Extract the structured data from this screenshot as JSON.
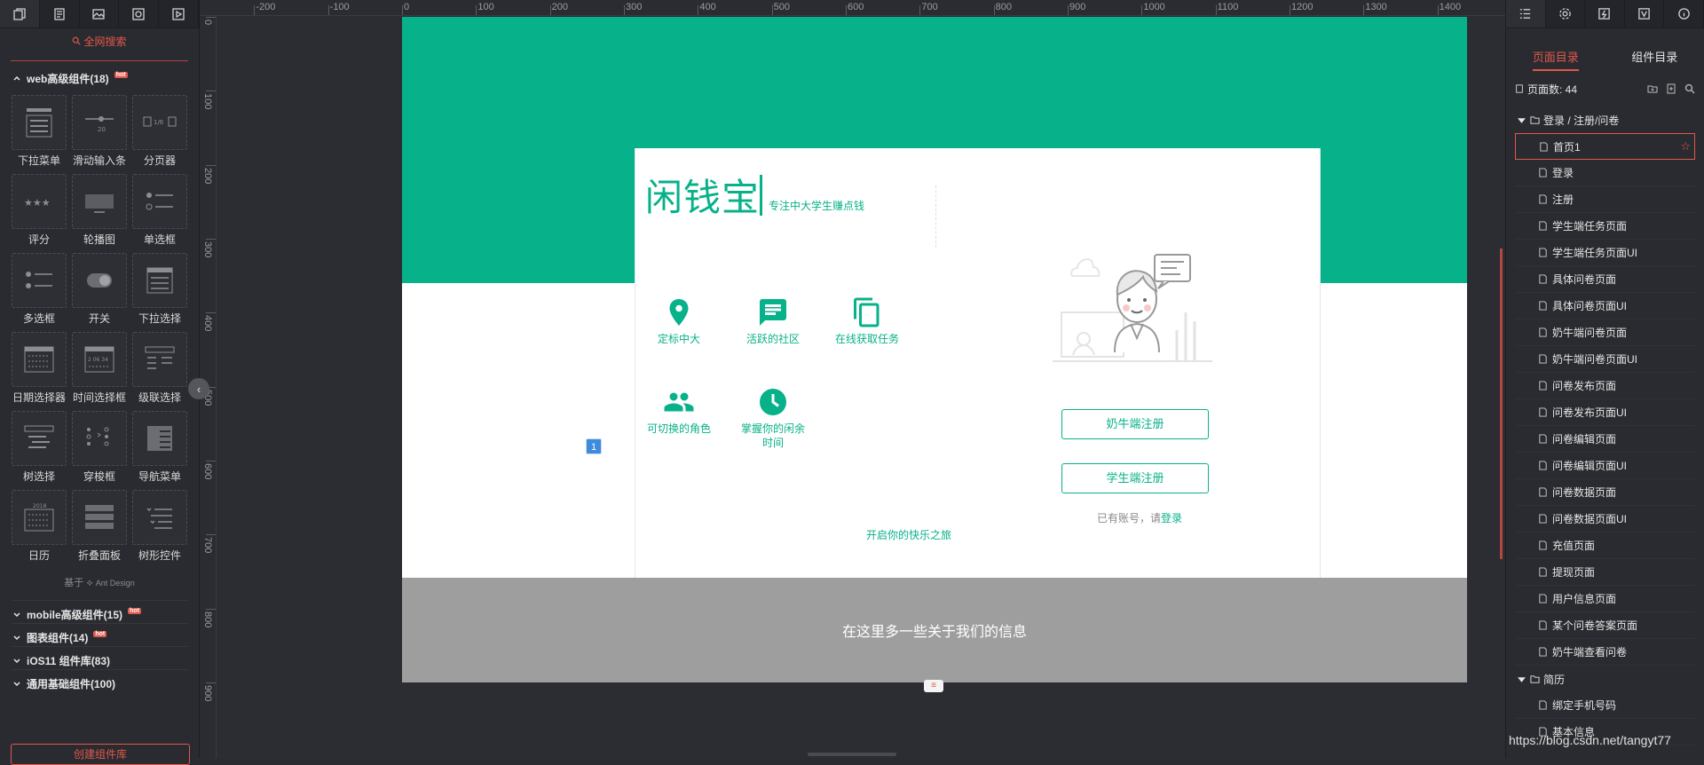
{
  "left_panel": {
    "tabs": [
      "pages-icon",
      "components-icon",
      "images-icon",
      "masters-icon",
      "interactions-icon"
    ],
    "search_label": "全网搜索",
    "group_title": "web高级组件(18)",
    "hot_badge": "hot",
    "components": [
      {
        "label": "下拉菜单",
        "icon": "dropdown-menu-icon"
      },
      {
        "label": "滑动输入条",
        "icon": "slider-icon",
        "value": "20"
      },
      {
        "label": "分页器",
        "icon": "pagination-icon",
        "value": "1/6"
      },
      {
        "label": "评分",
        "icon": "rating-icon"
      },
      {
        "label": "轮播图",
        "icon": "carousel-icon"
      },
      {
        "label": "单选框",
        "icon": "radio-icon"
      },
      {
        "label": "多选框",
        "icon": "checkbox-icon"
      },
      {
        "label": "开关",
        "icon": "switch-icon"
      },
      {
        "label": "下拉选择",
        "icon": "select-icon"
      },
      {
        "label": "日期选择器",
        "icon": "date-picker-icon"
      },
      {
        "label": "时间选择框",
        "icon": "time-picker-icon",
        "value": "2 06 34"
      },
      {
        "label": "级联选择",
        "icon": "cascader-icon"
      },
      {
        "label": "树选择",
        "icon": "tree-select-icon"
      },
      {
        "label": "穿梭框",
        "icon": "transfer-icon"
      },
      {
        "label": "导航菜单",
        "icon": "nav-menu-icon"
      },
      {
        "label": "日历",
        "icon": "calendar-icon",
        "value": "2018"
      },
      {
        "label": "折叠面板",
        "icon": "collapse-icon"
      },
      {
        "label": "树形控件",
        "icon": "tree-icon"
      }
    ],
    "based_on_prefix": "基于",
    "based_on_name": "Ant Design",
    "sub_groups": [
      {
        "label": "mobile高级组件(15)",
        "hot": true
      },
      {
        "label": "图表组件(14)",
        "hot": true
      },
      {
        "label": "iOS11 组件库(83)",
        "hot": false
      },
      {
        "label": "通用基础组件(100)",
        "hot": false
      }
    ],
    "create_button": "创建组件库"
  },
  "ruler": {
    "x_ticks": [
      "-200",
      "-100",
      "0",
      "100",
      "200",
      "300",
      "400",
      "500",
      "600",
      "700",
      "800",
      "900",
      "1000",
      "1100",
      "1200",
      "1300",
      "1400"
    ],
    "y_ticks": [
      "0",
      "100",
      "200",
      "300",
      "400",
      "500",
      "600",
      "700",
      "800",
      "900"
    ]
  },
  "artboard": {
    "brand_title": "闲钱宝",
    "brand_subtitle": "专注中大学生赚点钱",
    "features": [
      {
        "label": "定标中大",
        "icon": "location-pin-icon"
      },
      {
        "label": "活跃的社区",
        "icon": "chat-icon"
      },
      {
        "label": "在线获取任务",
        "icon": "copy-tasks-icon"
      },
      {
        "label": "可切换的角色",
        "icon": "people-icon"
      },
      {
        "label": "掌握你的闲余时间",
        "icon": "clock-icon"
      }
    ],
    "register_milk": "奶牛端注册",
    "register_student": "学生端注册",
    "login_hint": "已有账号，请",
    "login_link": "登录",
    "journey": "开启你的快乐之旅",
    "page_badge": "1",
    "footer_text": "在这里多一些关于我们的信息",
    "accent_color": "#07b189",
    "footer_color": "#9e9e9e"
  },
  "right_panel": {
    "tabs": [
      "outline-icon",
      "settings-icon",
      "interaction-icon",
      "variables-icon",
      "info-icon"
    ],
    "page_tab": "页面目录",
    "component_tab": "组件目录",
    "page_count_label": "页面数: 44",
    "folders": [
      {
        "name": "登录 / 注册/问卷",
        "pages": [
          "首页1",
          "登录",
          "注册",
          "学生端任务页面",
          "学生端任务页面UI",
          "具体问卷页面",
          "具体问卷页面UI",
          "奶牛端问卷页面",
          "奶牛端问卷页面UI",
          "问卷发布页面",
          "问卷发布页面UI",
          "问卷编辑页面",
          "问卷编辑页面UI",
          "问卷数据页面",
          "问卷数据页面UI",
          "充值页面",
          "提现页面",
          "用户信息页面",
          "某个问卷答案页面",
          "奶牛端查看问卷"
        ]
      },
      {
        "name": "简历",
        "pages": [
          "绑定手机号码",
          "基本信息"
        ]
      }
    ],
    "selected_page": "首页1"
  },
  "watermark": "https://blog.csdn.net/tangyt77"
}
